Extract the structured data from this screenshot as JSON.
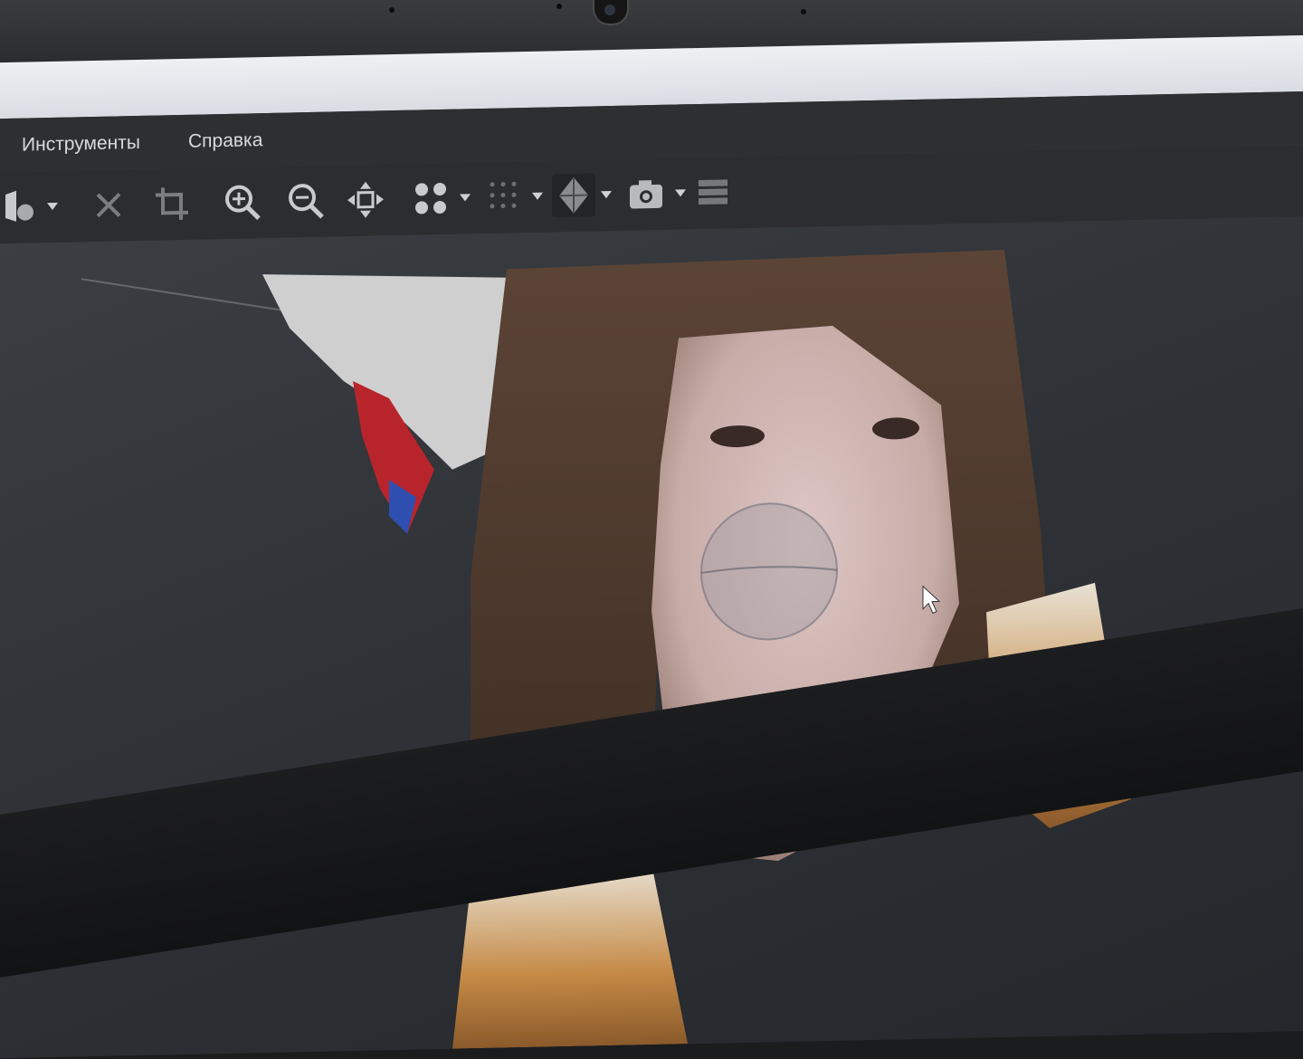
{
  "menu": {
    "tools_label": "Инструменты",
    "help_label": "Справка"
  },
  "toolbar": {
    "icons": [
      "select-hand-icon",
      "delete-x-icon",
      "crop-icon",
      "zoom-in-icon",
      "zoom-out-icon",
      "move-icon",
      "points-view-icon",
      "grid-view-icon",
      "mesh-view-icon",
      "camera-icon",
      "layers-icon"
    ]
  },
  "colors": {
    "menubar": "#2e2f32",
    "toolbar": "#2c2d30",
    "viewport": "#2f3237",
    "titlebar": "#e4e7eb"
  }
}
